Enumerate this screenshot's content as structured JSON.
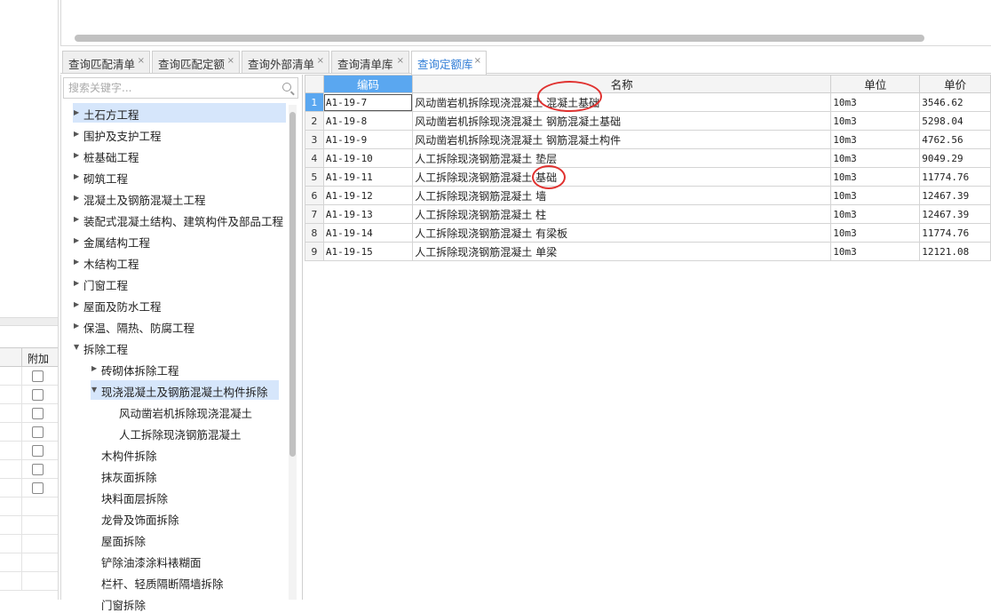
{
  "tabs": [
    {
      "label": "查询匹配清单",
      "active": false
    },
    {
      "label": "查询匹配定额",
      "active": false
    },
    {
      "label": "查询外部清单",
      "active": false
    },
    {
      "label": "查询清单库",
      "active": false
    },
    {
      "label": "查询定额库",
      "active": true
    }
  ],
  "tab_close_glyph": "×",
  "search": {
    "placeholder": "搜索关键字..."
  },
  "left_grid": {
    "header": "附加",
    "checkbox_count": 7
  },
  "tree": [
    {
      "label": "土石方工程",
      "level": 0,
      "expanded": false,
      "selected": true
    },
    {
      "label": "围护及支护工程",
      "level": 0,
      "expanded": false
    },
    {
      "label": "桩基础工程",
      "level": 0,
      "expanded": false
    },
    {
      "label": "砌筑工程",
      "level": 0,
      "expanded": false
    },
    {
      "label": "混凝土及钢筋混凝土工程",
      "level": 0,
      "expanded": false
    },
    {
      "label": "装配式混凝土结构、建筑构件及部品工程",
      "level": 0,
      "expanded": false
    },
    {
      "label": "金属结构工程",
      "level": 0,
      "expanded": false
    },
    {
      "label": "木结构工程",
      "level": 0,
      "expanded": false
    },
    {
      "label": "门窗工程",
      "level": 0,
      "expanded": false
    },
    {
      "label": "屋面及防水工程",
      "level": 0,
      "expanded": false
    },
    {
      "label": "保温、隔热、防腐工程",
      "level": 0,
      "expanded": false
    },
    {
      "label": "拆除工程",
      "level": 0,
      "expanded": true
    },
    {
      "label": "砖砌体拆除工程",
      "level": 1,
      "expanded": false
    },
    {
      "label": "现浇混凝土及钢筋混凝土构件拆除",
      "level": 1,
      "expanded": true,
      "selected": true
    },
    {
      "label": "风动凿岩机拆除现浇混凝土",
      "level": 2
    },
    {
      "label": "人工拆除现浇钢筋混凝土",
      "level": 2
    },
    {
      "label": "木构件拆除",
      "level": 1
    },
    {
      "label": "抹灰面拆除",
      "level": 1
    },
    {
      "label": "块料面层拆除",
      "level": 1
    },
    {
      "label": "龙骨及饰面拆除",
      "level": 1
    },
    {
      "label": "屋面拆除",
      "level": 1
    },
    {
      "label": "铲除油漆涂料裱糊面",
      "level": 1
    },
    {
      "label": "栏杆、轻质隔断隔墙拆除",
      "level": 1
    },
    {
      "label": "门窗拆除",
      "level": 1
    }
  ],
  "table": {
    "columns": [
      "编码",
      "名称",
      "单位",
      "单价"
    ],
    "rows": [
      {
        "no": "1",
        "code": "A1-19-7",
        "name": "风动凿岩机拆除现浇混凝土 混凝土基础",
        "unit": "10m3",
        "price": "3546.62"
      },
      {
        "no": "2",
        "code": "A1-19-8",
        "name": "风动凿岩机拆除现浇混凝土 钢筋混凝土基础",
        "unit": "10m3",
        "price": "5298.04"
      },
      {
        "no": "3",
        "code": "A1-19-9",
        "name": "风动凿岩机拆除现浇混凝土 钢筋混凝土构件",
        "unit": "10m3",
        "price": "4762.56"
      },
      {
        "no": "4",
        "code": "A1-19-10",
        "name": "人工拆除现浇钢筋混凝土 垫层",
        "unit": "10m3",
        "price": "9049.29"
      },
      {
        "no": "5",
        "code": "A1-19-11",
        "name": "人工拆除现浇钢筋混凝土 基础",
        "unit": "10m3",
        "price": "11774.76"
      },
      {
        "no": "6",
        "code": "A1-19-12",
        "name": "人工拆除现浇钢筋混凝土 墙",
        "unit": "10m3",
        "price": "12467.39"
      },
      {
        "no": "7",
        "code": "A1-19-13",
        "name": "人工拆除现浇钢筋混凝土 柱",
        "unit": "10m3",
        "price": "12467.39"
      },
      {
        "no": "8",
        "code": "A1-19-14",
        "name": "人工拆除现浇钢筋混凝土 有梁板",
        "unit": "10m3",
        "price": "11774.76"
      },
      {
        "no": "9",
        "code": "A1-19-15",
        "name": "人工拆除现浇钢筋混凝土 单梁",
        "unit": "10m3",
        "price": "12121.08"
      }
    ]
  },
  "colors": {
    "accent": "#2f7cd6",
    "header_blue": "#5aa7f0",
    "annotation_red": "#e0312f",
    "selection": "#d6e6fb"
  }
}
